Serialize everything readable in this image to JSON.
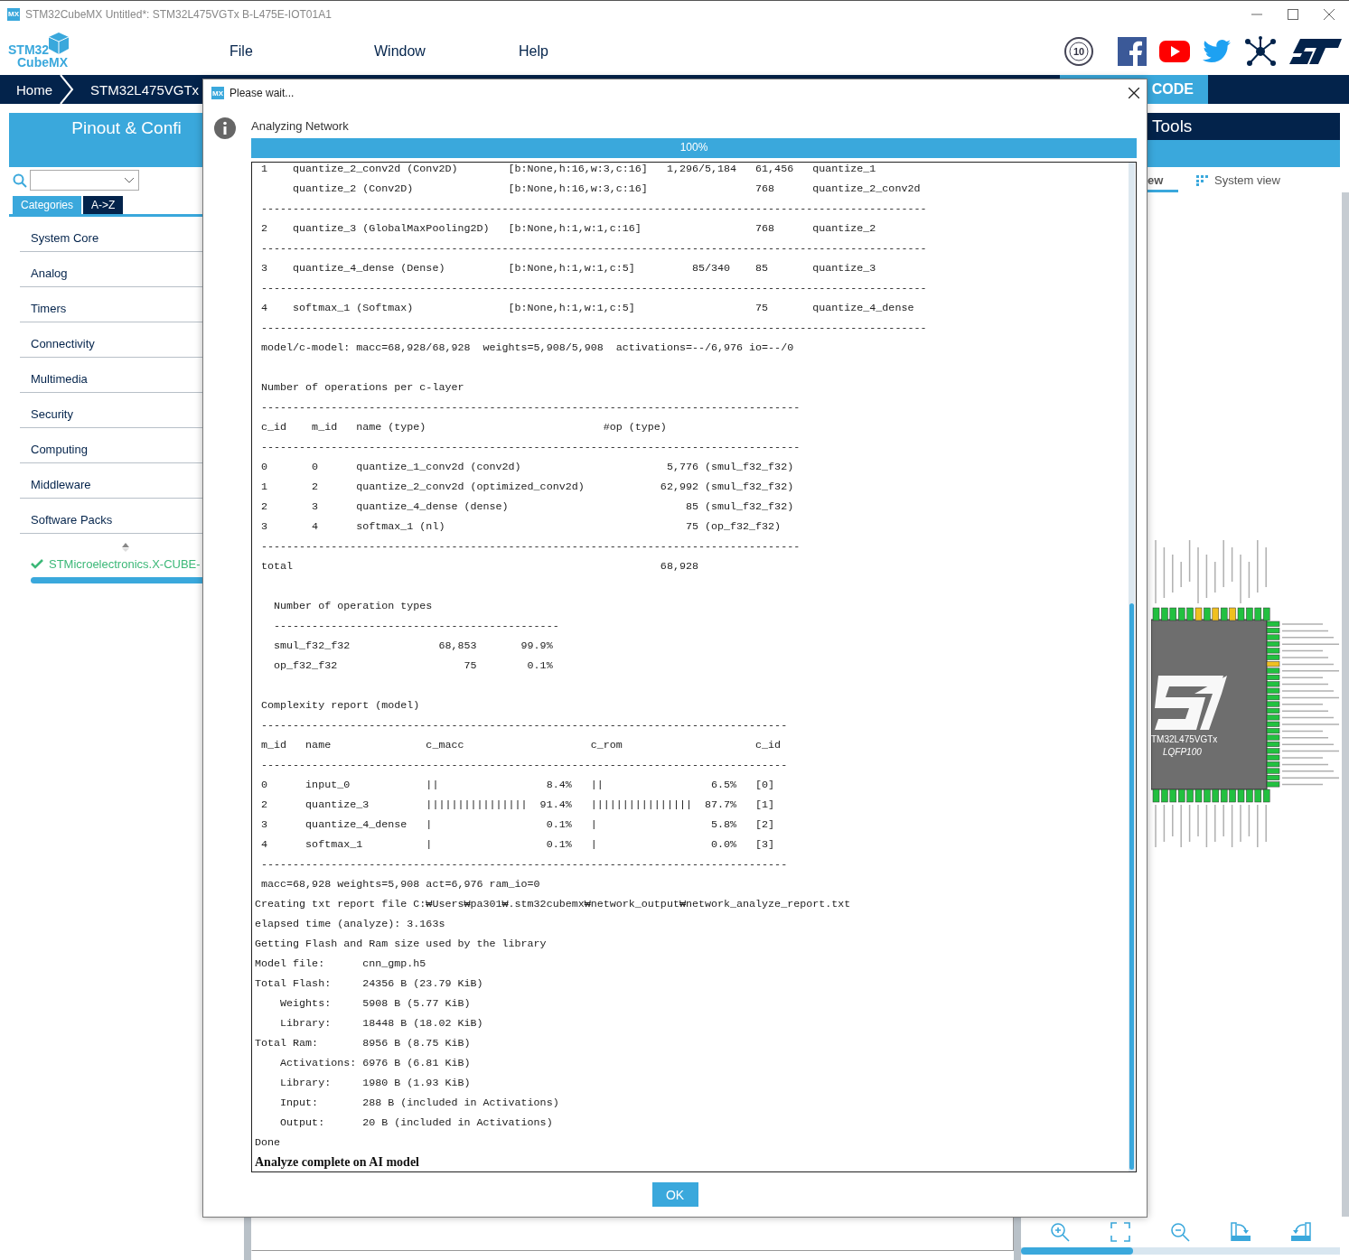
{
  "window": {
    "icon_text": "MX",
    "title": "STM32CubeMX Untitled*: STM32L475VGTx B-L475E-IOT01A1"
  },
  "logo": {
    "line1": "STM32",
    "line2": "CubeMX"
  },
  "menu": [
    "File",
    "Window",
    "Help"
  ],
  "anniversary_badge": "10",
  "breadcrumb": [
    "Home",
    "STM32L475VGTx"
  ],
  "generate_button": "CODE",
  "left_panel": {
    "title": "Pinout & Confi",
    "tabs": [
      {
        "label": "Categories",
        "selected": true
      },
      {
        "label": "A->Z",
        "selected": false
      }
    ],
    "categories": [
      "System Core",
      "Analog",
      "Timers",
      "Connectivity",
      "Multimedia",
      "Security",
      "Computing",
      "Middleware",
      "Software Packs"
    ],
    "pack": {
      "label": "STMicroelectronics.X-CUBE-",
      "checked": true
    }
  },
  "right_panel": {
    "title": "Tools",
    "views": [
      {
        "label": "ew",
        "selected": true
      },
      {
        "label": "System view",
        "selected": false
      }
    ],
    "chip": {
      "name": "TM32L475VGTx",
      "package": "LQFP100"
    }
  },
  "dialog": {
    "icon_text": "MX",
    "title": "Please wait...",
    "message": "Analyzing Network",
    "progress": {
      "level": 1,
      "label": "100%"
    },
    "log": [
      [
        " 1    quantize_2_conv2d (Conv2D)        [b:None,h:16,w:3,c:16]   1,296/5,184   61,456   quantize_1",
        "      quantize_2 (Conv2D)               [b:None,h:16,w:3,c:16]                 768      quantize_2_conv2d",
        " ---------------------------------------------------------------------------------------------------------",
        " 2    quantize_3 (GlobalMaxPooling2D)   [b:None,h:1,w:1,c:16]                  768      quantize_2",
        " ---------------------------------------------------------------------------------------------------------",
        " 3    quantize_4_dense (Dense)          [b:None,h:1,w:1,c:5]         85/340    85       quantize_3",
        " ---------------------------------------------------------------------------------------------------------",
        " 4    softmax_1 (Softmax)               [b:None,h:1,w:1,c:5]                   75       quantize_4_dense",
        " ---------------------------------------------------------------------------------------------------------",
        " model/c-model: macc=68,928/68,928  weights=5,908/5,908  activations=--/6,976 io=--/0"
      ],
      [
        " Number of operations per c-layer",
        " -------------------------------------------------------------------------------------",
        " c_id    m_id   name (type)                            #op (type)",
        " -------------------------------------------------------------------------------------",
        " 0       0      quantize_1_conv2d (conv2d)                       5,776 (smul_f32_f32)",
        " 1       2      quantize_2_conv2d (optimized_conv2d)            62,992 (smul_f32_f32)",
        " 2       3      quantize_4_dense (dense)                            85 (smul_f32_f32)",
        " 3       4      softmax_1 (nl)                                      75 (op_f32_f32)",
        " -------------------------------------------------------------------------------------",
        " total                                                          68,928"
      ],
      [
        "   Number of operation types",
        "   ---------------------------------------------",
        "   smul_f32_f32              68,853       99.9%",
        "   op_f32_f32                    75        0.1%"
      ],
      [
        " Complexity report (model)",
        " -----------------------------------------------------------------------------------",
        " m_id   name               c_macc                    c_rom                     c_id",
        " -----------------------------------------------------------------------------------",
        " 0      input_0            ||                 8.4%   ||                 6.5%   [0]",
        " 2      quantize_3         ||||||||||||||||  91.4%   ||||||||||||||||  87.7%   [1]",
        " 3      quantize_4_dense   |                  0.1%   |                  5.8%   [2]",
        " 4      softmax_1          |                  0.1%   |                  0.0%   [3]",
        " -----------------------------------------------------------------------------------",
        " macc=68,928 weights=5,908 act=6,976 ram_io=0",
        "Creating txt report file C:₩Users₩pa301₩.stm32cubemx₩network_output₩network_analyze_report.txt",
        "elapsed time (analyze): 3.163s",
        "Getting Flash and Ram size used by the library",
        "Model file:      cnn_gmp.h5",
        "Total Flash:     24356 B (23.79 KiB)",
        "    Weights:     5908 B (5.77 KiB)",
        "    Library:     18448 B (18.02 KiB)",
        "Total Ram:       8956 B (8.75 KiB)",
        "    Activations: 6976 B (6.81 KiB)",
        "    Library:     1980 B (1.93 KiB)",
        "    Input:       288 B (included in Activations)",
        "    Output:      20 B (included in Activations)",
        "Done"
      ]
    ],
    "final_line": "Analyze complete on AI model",
    "ok_button": "OK"
  }
}
